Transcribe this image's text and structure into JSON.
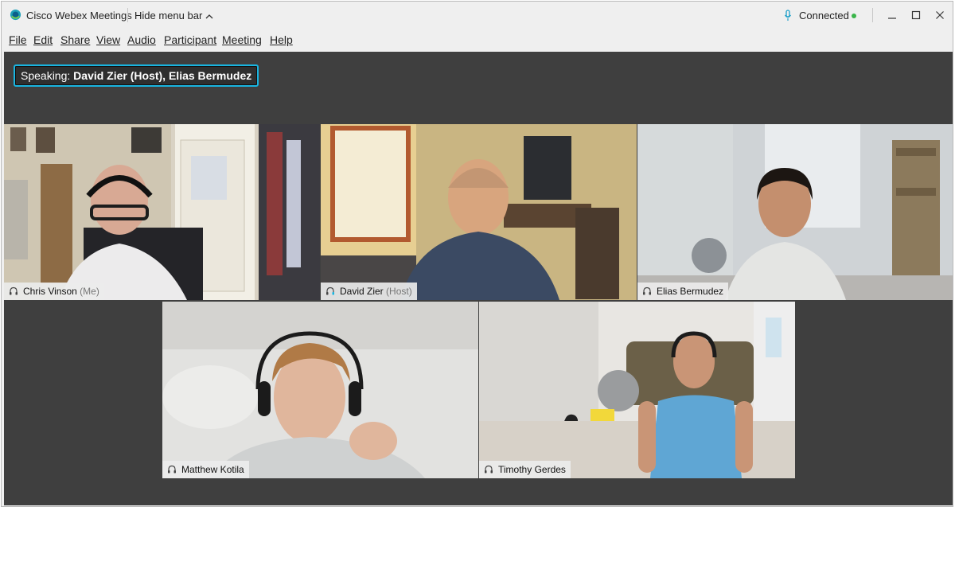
{
  "window": {
    "app_title": "Cisco Webex Meetings",
    "hide_menu_label": "Hide menu bar",
    "connection_status": "Connected"
  },
  "menu": [
    {
      "label": "File"
    },
    {
      "label": "Edit"
    },
    {
      "label": "Share"
    },
    {
      "label": "View"
    },
    {
      "label": "Audio"
    },
    {
      "label": "Participant"
    },
    {
      "label": "Meeting"
    },
    {
      "label": "Help"
    }
  ],
  "speaking": {
    "prefix": "Speaking:",
    "names": "David Zier (Host), Elias Bermudez"
  },
  "participants": [
    {
      "name": "Chris Vinson",
      "role": "(Me)",
      "active": false
    },
    {
      "name": "David Zier",
      "role": "(Host)",
      "active": true
    },
    {
      "name": "Elias Bermudez",
      "role": "",
      "active": true
    },
    {
      "name": "Matthew Kotila",
      "role": "",
      "active": false
    },
    {
      "name": "Timothy Gerdes",
      "role": "",
      "active": false
    }
  ],
  "colors": {
    "accent": "#19b4e0",
    "connected": "#3ab54a",
    "stage_bg": "#3f3f3f"
  },
  "icons": [
    "webex-logo-icon",
    "chevron-up-icon",
    "microphone-icon",
    "minimize-icon",
    "maximize-icon",
    "close-icon",
    "headset-icon"
  ]
}
